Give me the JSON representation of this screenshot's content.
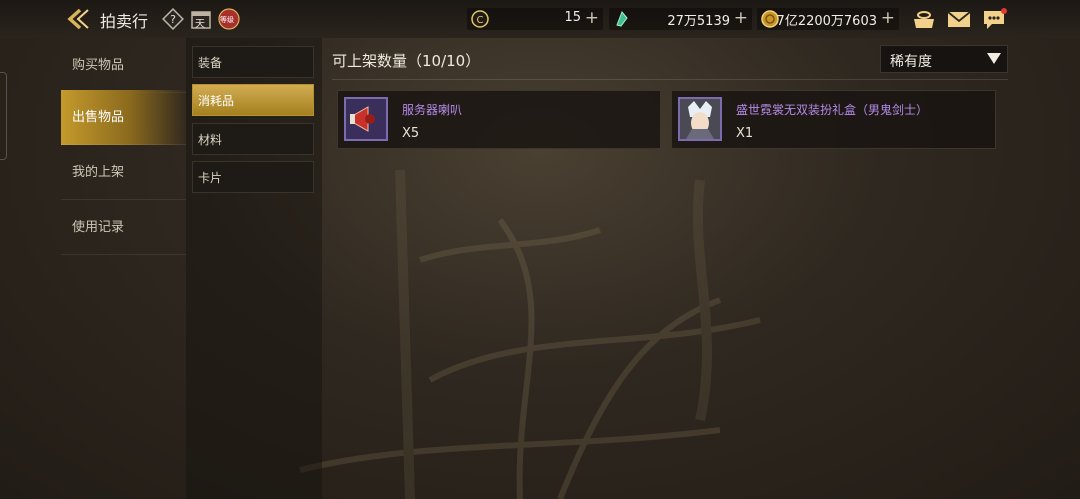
{
  "header": {
    "title": "拍卖行",
    "level_badge_text": "等级",
    "calendar_char": "天"
  },
  "currencies": [
    {
      "icon": "c-coin-icon",
      "value": "15"
    },
    {
      "icon": "green-crystal-icon",
      "value": "27万5139"
    },
    {
      "icon": "gold-coin-icon",
      "value": "7亿2200万7603"
    }
  ],
  "plus_symbol": "+",
  "nav": {
    "items": [
      {
        "label": "购买物品",
        "active": false
      },
      {
        "label": "出售物品",
        "active": true
      },
      {
        "label": "我的上架",
        "active": false
      },
      {
        "label": "使用记录",
        "active": false
      }
    ]
  },
  "categories": [
    {
      "label": "装备",
      "active": false
    },
    {
      "label": "消耗品",
      "active": true
    },
    {
      "label": "材料",
      "active": false
    },
    {
      "label": "卡片",
      "active": false
    }
  ],
  "main": {
    "count_label": "可上架数量（10/10）",
    "sort_label": "稀有度"
  },
  "items": [
    {
      "name": "服务器喇叭",
      "qty": "X5",
      "icon": "megaphone-icon"
    },
    {
      "name": "盛世霓裳无双装扮礼盒（男鬼剑士）",
      "qty": "X1",
      "icon": "character-portrait-icon"
    }
  ],
  "colors": {
    "accent_gold": "#c49a2c",
    "item_name_purple": "#b48ae8"
  }
}
